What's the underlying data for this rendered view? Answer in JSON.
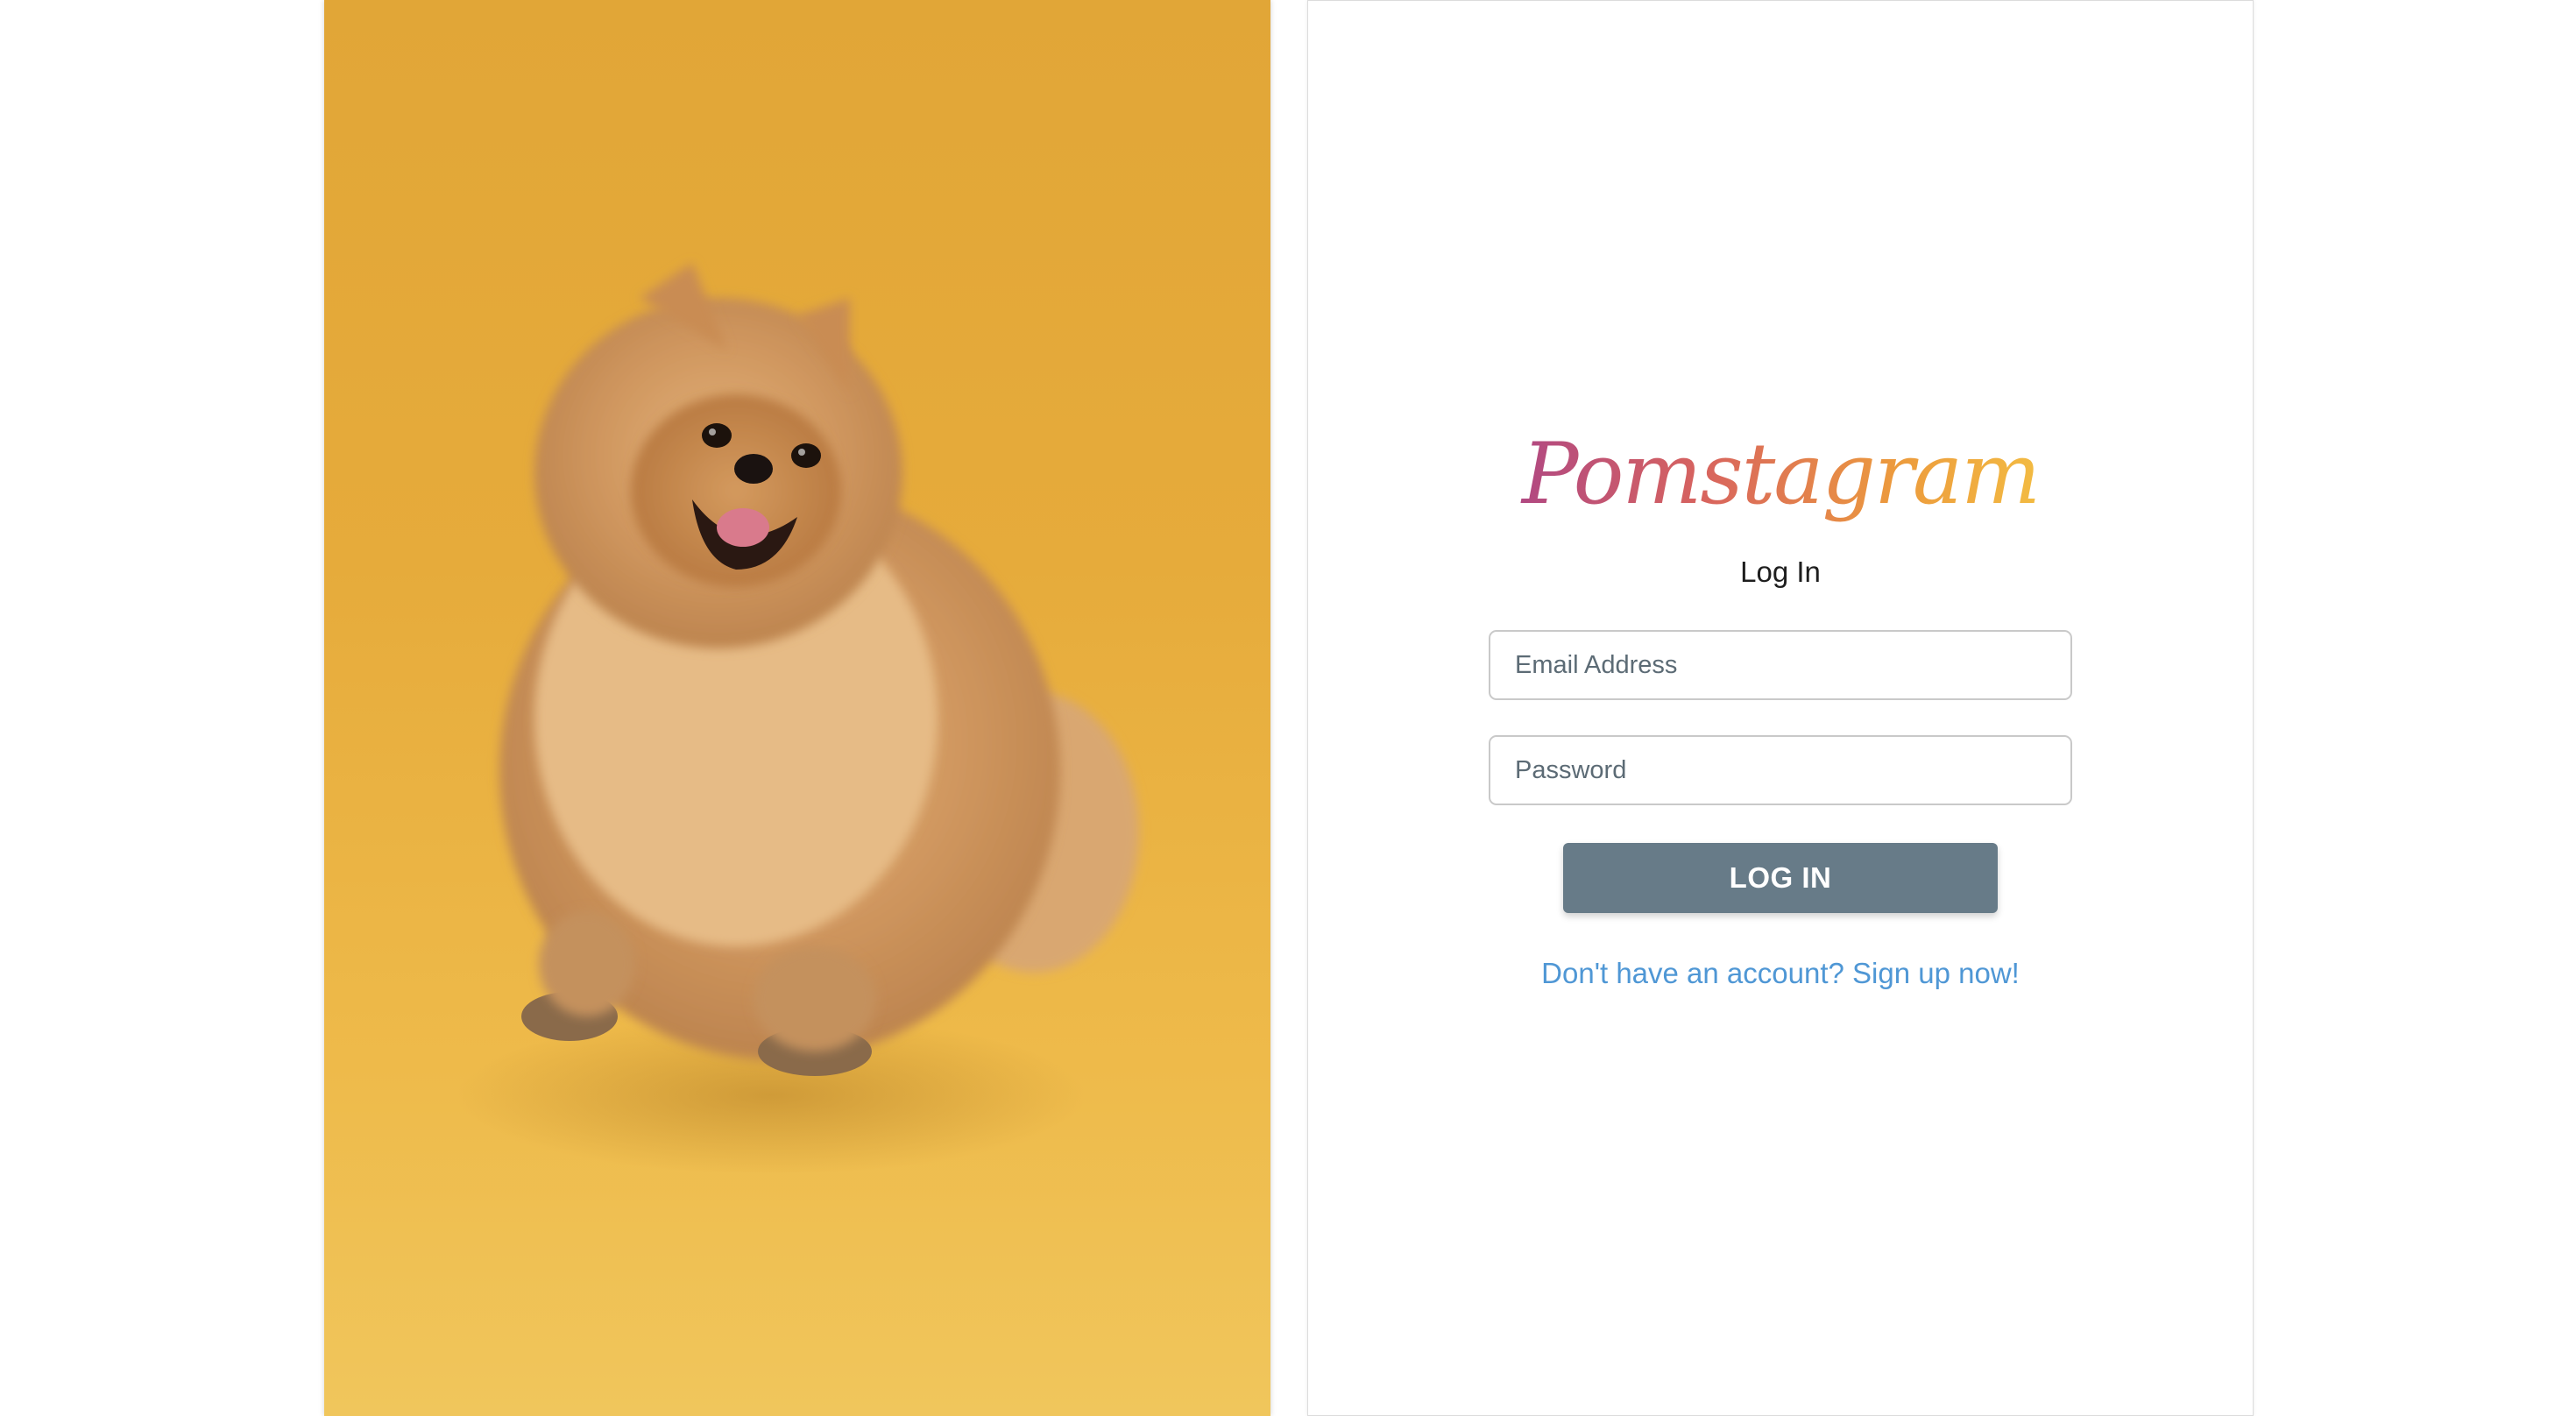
{
  "brand": {
    "logo_text": "Pomstagram",
    "logo_gradient": [
      "#7a2f8f",
      "#d8645e",
      "#ec9a3d",
      "#fde24e"
    ]
  },
  "photo": {
    "subject": "pomeranian-dog",
    "background_color": "#e6ab3b"
  },
  "login": {
    "heading": "Log In",
    "email_placeholder": "Email Address",
    "password_placeholder": "Password",
    "submit_label": "LOG IN",
    "signup_link": "Don't have an account? Sign up now!"
  },
  "colors": {
    "button": "#677b88",
    "link": "#4f97d5"
  }
}
